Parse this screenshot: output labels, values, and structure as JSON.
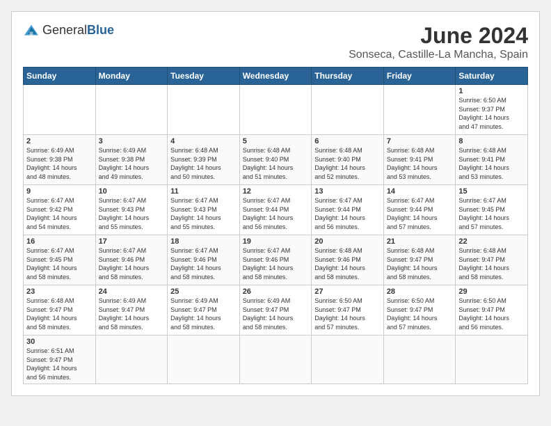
{
  "header": {
    "logo_general": "General",
    "logo_blue": "Blue",
    "month_title": "June 2024",
    "subtitle": "Sonseca, Castille-La Mancha, Spain"
  },
  "days_of_week": [
    "Sunday",
    "Monday",
    "Tuesday",
    "Wednesday",
    "Thursday",
    "Friday",
    "Saturday"
  ],
  "weeks": [
    {
      "cells": [
        {
          "day": null,
          "info": null
        },
        {
          "day": null,
          "info": null
        },
        {
          "day": null,
          "info": null
        },
        {
          "day": null,
          "info": null
        },
        {
          "day": null,
          "info": null
        },
        {
          "day": null,
          "info": null
        },
        {
          "day": "1",
          "info": "Sunrise: 6:50 AM\nSunset: 9:37 PM\nDaylight: 14 hours\nand 47 minutes."
        }
      ]
    },
    {
      "cells": [
        {
          "day": "2",
          "info": "Sunrise: 6:49 AM\nSunset: 9:38 PM\nDaylight: 14 hours\nand 48 minutes."
        },
        {
          "day": "3",
          "info": "Sunrise: 6:49 AM\nSunset: 9:38 PM\nDaylight: 14 hours\nand 49 minutes."
        },
        {
          "day": "4",
          "info": "Sunrise: 6:48 AM\nSunset: 9:39 PM\nDaylight: 14 hours\nand 50 minutes."
        },
        {
          "day": "5",
          "info": "Sunrise: 6:48 AM\nSunset: 9:40 PM\nDaylight: 14 hours\nand 51 minutes."
        },
        {
          "day": "6",
          "info": "Sunrise: 6:48 AM\nSunset: 9:40 PM\nDaylight: 14 hours\nand 52 minutes."
        },
        {
          "day": "7",
          "info": "Sunrise: 6:48 AM\nSunset: 9:41 PM\nDaylight: 14 hours\nand 53 minutes."
        },
        {
          "day": "8",
          "info": "Sunrise: 6:48 AM\nSunset: 9:41 PM\nDaylight: 14 hours\nand 53 minutes."
        }
      ]
    },
    {
      "cells": [
        {
          "day": "9",
          "info": "Sunrise: 6:47 AM\nSunset: 9:42 PM\nDaylight: 14 hours\nand 54 minutes."
        },
        {
          "day": "10",
          "info": "Sunrise: 6:47 AM\nSunset: 9:43 PM\nDaylight: 14 hours\nand 55 minutes."
        },
        {
          "day": "11",
          "info": "Sunrise: 6:47 AM\nSunset: 9:43 PM\nDaylight: 14 hours\nand 55 minutes."
        },
        {
          "day": "12",
          "info": "Sunrise: 6:47 AM\nSunset: 9:44 PM\nDaylight: 14 hours\nand 56 minutes."
        },
        {
          "day": "13",
          "info": "Sunrise: 6:47 AM\nSunset: 9:44 PM\nDaylight: 14 hours\nand 56 minutes."
        },
        {
          "day": "14",
          "info": "Sunrise: 6:47 AM\nSunset: 9:44 PM\nDaylight: 14 hours\nand 57 minutes."
        },
        {
          "day": "15",
          "info": "Sunrise: 6:47 AM\nSunset: 9:45 PM\nDaylight: 14 hours\nand 57 minutes."
        }
      ]
    },
    {
      "cells": [
        {
          "day": "16",
          "info": "Sunrise: 6:47 AM\nSunset: 9:45 PM\nDaylight: 14 hours\nand 58 minutes."
        },
        {
          "day": "17",
          "info": "Sunrise: 6:47 AM\nSunset: 9:46 PM\nDaylight: 14 hours\nand 58 minutes."
        },
        {
          "day": "18",
          "info": "Sunrise: 6:47 AM\nSunset: 9:46 PM\nDaylight: 14 hours\nand 58 minutes."
        },
        {
          "day": "19",
          "info": "Sunrise: 6:47 AM\nSunset: 9:46 PM\nDaylight: 14 hours\nand 58 minutes."
        },
        {
          "day": "20",
          "info": "Sunrise: 6:48 AM\nSunset: 9:46 PM\nDaylight: 14 hours\nand 58 minutes."
        },
        {
          "day": "21",
          "info": "Sunrise: 6:48 AM\nSunset: 9:47 PM\nDaylight: 14 hours\nand 58 minutes."
        },
        {
          "day": "22",
          "info": "Sunrise: 6:48 AM\nSunset: 9:47 PM\nDaylight: 14 hours\nand 58 minutes."
        }
      ]
    },
    {
      "cells": [
        {
          "day": "23",
          "info": "Sunrise: 6:48 AM\nSunset: 9:47 PM\nDaylight: 14 hours\nand 58 minutes."
        },
        {
          "day": "24",
          "info": "Sunrise: 6:49 AM\nSunset: 9:47 PM\nDaylight: 14 hours\nand 58 minutes."
        },
        {
          "day": "25",
          "info": "Sunrise: 6:49 AM\nSunset: 9:47 PM\nDaylight: 14 hours\nand 58 minutes."
        },
        {
          "day": "26",
          "info": "Sunrise: 6:49 AM\nSunset: 9:47 PM\nDaylight: 14 hours\nand 58 minutes."
        },
        {
          "day": "27",
          "info": "Sunrise: 6:50 AM\nSunset: 9:47 PM\nDaylight: 14 hours\nand 57 minutes."
        },
        {
          "day": "28",
          "info": "Sunrise: 6:50 AM\nSunset: 9:47 PM\nDaylight: 14 hours\nand 57 minutes."
        },
        {
          "day": "29",
          "info": "Sunrise: 6:50 AM\nSunset: 9:47 PM\nDaylight: 14 hours\nand 56 minutes."
        }
      ]
    },
    {
      "cells": [
        {
          "day": "30",
          "info": "Sunrise: 6:51 AM\nSunset: 9:47 PM\nDaylight: 14 hours\nand 56 minutes."
        },
        {
          "day": null,
          "info": null
        },
        {
          "day": null,
          "info": null
        },
        {
          "day": null,
          "info": null
        },
        {
          "day": null,
          "info": null
        },
        {
          "day": null,
          "info": null
        },
        {
          "day": null,
          "info": null
        }
      ]
    }
  ]
}
